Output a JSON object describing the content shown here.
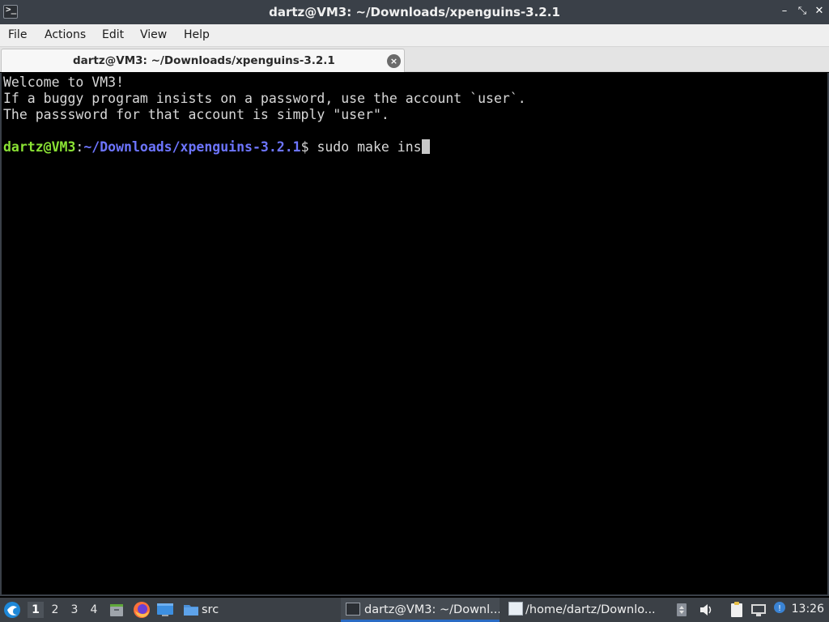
{
  "window": {
    "title": "dartz@VM3: ~/Downloads/xpenguins-3.2.1",
    "app_icon_glyph": ">_",
    "controls": {
      "minimize": "–",
      "maximize": "⤡",
      "close": "✕"
    }
  },
  "menu": {
    "items": [
      "File",
      "Actions",
      "Edit",
      "View",
      "Help"
    ]
  },
  "tab": {
    "label": "dartz@VM3: ~/Downloads/xpenguins-3.2.1",
    "close_glyph": "×"
  },
  "terminal": {
    "lines": [
      "Welcome to VM3!",
      "If a buggy program insists on a password, use the account `user`.",
      "The passsword for that account is simply \"user\".",
      ""
    ],
    "prompt": {
      "user_host": "dartz@VM3",
      "separator": ":",
      "path": "~/Downloads/xpenguins-3.2.1",
      "symbol": "$ ",
      "command": "sudo make ins"
    },
    "colors": {
      "user_host": "#8ae234",
      "path": "#6d75ff",
      "text": "#d8d8d8",
      "background": "#000000"
    }
  },
  "taskbar": {
    "workspaces": [
      "1",
      "2",
      "3",
      "4"
    ],
    "active_workspace": "1",
    "quicklaunch": [
      "file-manager-icon",
      "firefox-icon",
      "desktop-icon"
    ],
    "folder_label": "src",
    "tasks": [
      {
        "label": "dartz@VM3: ~/Downl...",
        "icon": "terminal-icon",
        "active": true
      },
      {
        "label": "/home/dartz/Downlo...",
        "icon": "text-editor-icon",
        "active": false
      }
    ],
    "tray_icons": [
      "arrow-tray-icon",
      "volume-icon",
      "clipboard-icon",
      "network-icon",
      "update-icon"
    ],
    "clock": "13:26"
  }
}
